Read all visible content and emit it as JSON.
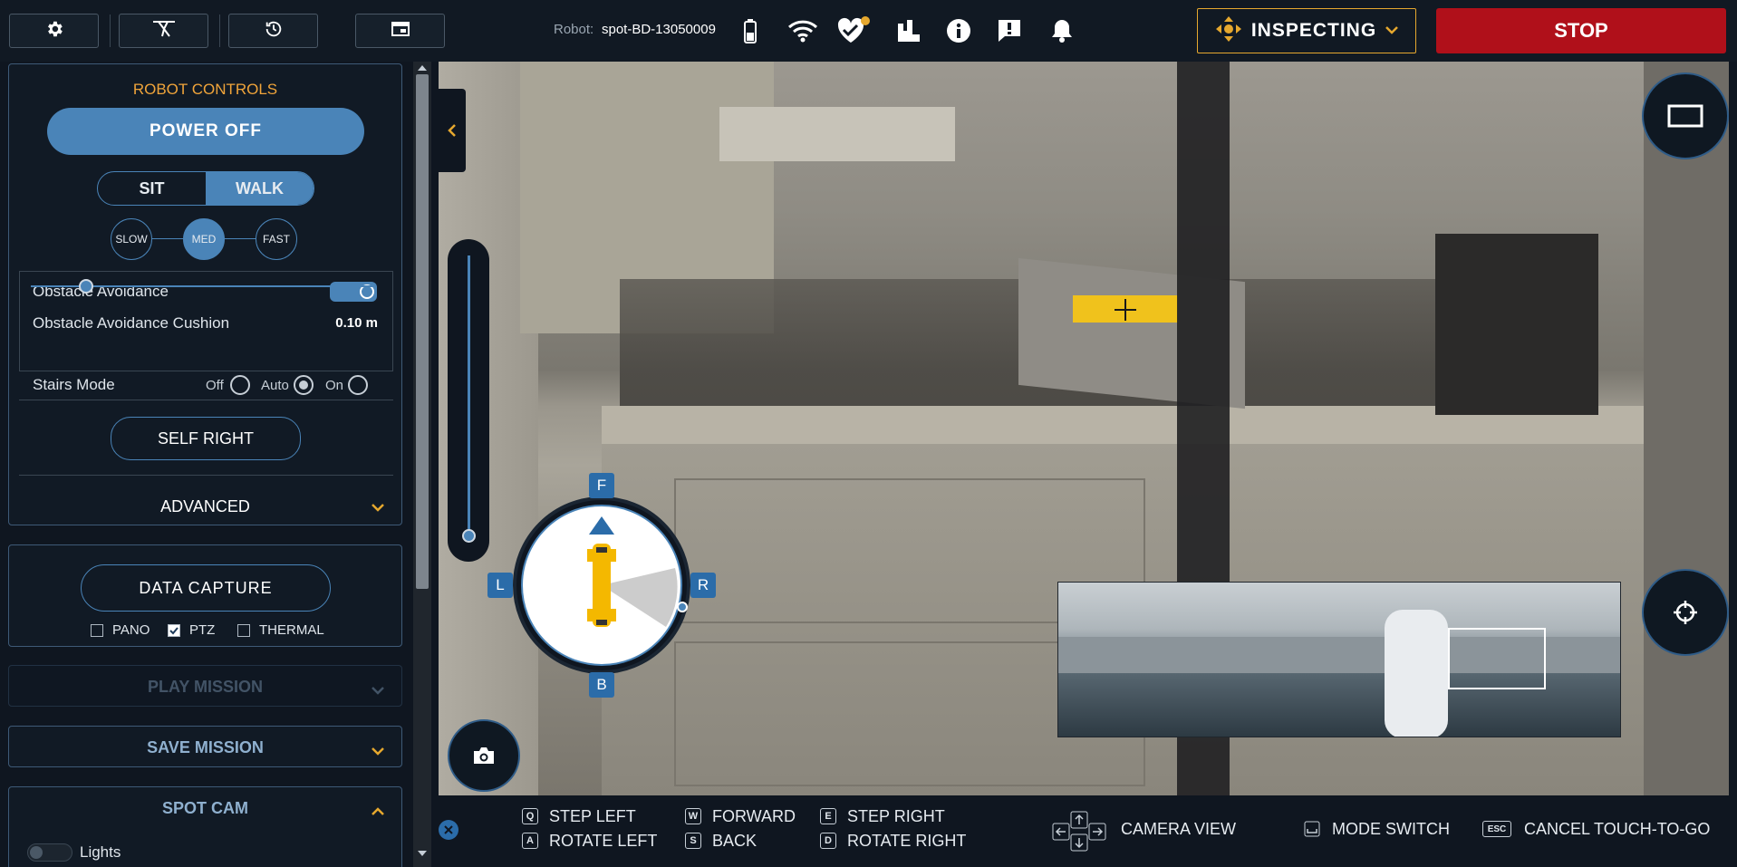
{
  "topbar": {
    "robot_label": "Robot:",
    "robot_name": "spot-BD-13050009",
    "mode_label": "INSPECTING",
    "stop_label": "STOP",
    "accent_color": "#e6a82e",
    "stop_color": "#b0101a",
    "icons": [
      "gear-icon",
      "robot-pose-icon",
      "history-icon",
      "window-icon",
      "battery-icon",
      "wifi-icon",
      "health-icon",
      "payload-icon",
      "info-icon",
      "alert-icon",
      "bell-icon"
    ]
  },
  "robot_controls": {
    "title": "ROBOT CONTROLS",
    "power_off": "POWER OFF",
    "sit": "SIT",
    "walk": "WALK",
    "speeds": [
      "SLOW",
      "MED",
      "FAST"
    ],
    "selected_speed": "MED",
    "obstacle_avoidance": "Obstacle Avoidance",
    "obstacle_avoidance_on": true,
    "cushion_label": "Obstacle Avoidance Cushion",
    "cushion_value": "0.10 m",
    "stairs_mode": "Stairs Mode",
    "stairs_options": [
      "Off",
      "Auto",
      "On"
    ],
    "stairs_selected": "Auto",
    "self_right": "SELF RIGHT",
    "advanced": "ADVANCED"
  },
  "data_capture": {
    "button": "DATA CAPTURE",
    "options": [
      {
        "label": "PANO",
        "checked": false
      },
      {
        "label": "PTZ",
        "checked": true
      },
      {
        "label": "THERMAL",
        "checked": false
      }
    ]
  },
  "sections": {
    "play_mission": "PLAY MISSION",
    "save_mission": "SAVE MISSION",
    "spot_cam": "SPOT CAM",
    "lights": "Lights"
  },
  "compass": {
    "front": "F",
    "back": "B",
    "left": "L",
    "right": "R"
  },
  "shortcuts": {
    "q_key": "Q",
    "q_label": "STEP LEFT",
    "a_key": "A",
    "a_label": "ROTATE LEFT",
    "w_key": "W",
    "w_label": "FORWARD",
    "s_key": "S",
    "s_label": "BACK",
    "e_key": "E",
    "e_label": "STEP RIGHT",
    "d_key": "D",
    "d_label": "ROTATE RIGHT",
    "camera_view": "CAMERA VIEW",
    "mode_switch": "MODE SWITCH",
    "esc_key": "ESC",
    "cancel_touch": "CANCEL TOUCH-TO-GO"
  }
}
